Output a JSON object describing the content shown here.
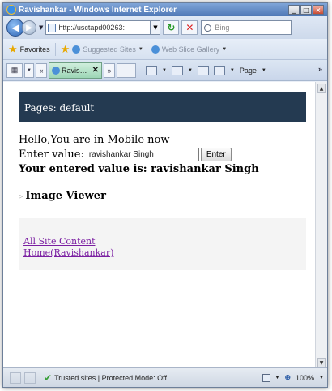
{
  "window": {
    "title": "Ravishankar - Windows Internet Explorer",
    "controls": [
      "_",
      "□",
      "×"
    ]
  },
  "addressbar": {
    "url": "http://usctapd00263:",
    "search_placeholder": "Bing"
  },
  "favorites_bar": {
    "favorites_label": "Favorites",
    "items": [
      "Suggested Sites",
      "Web Slice Gallery"
    ]
  },
  "tabbar": {
    "tab_label": "Ravis…",
    "page_menu": "Page",
    "more": "»",
    "scroll_left": "«",
    "scroll_right": "»"
  },
  "page": {
    "header": "Pages: default",
    "greeting": "Hello,You are in Mobile now",
    "enter_label": "Enter value:",
    "input_value": "ravishankar Singh",
    "enter_button": "Enter",
    "result": "Your entered value is: ravishankar Singh",
    "image_viewer": "Image Viewer",
    "links": [
      "All Site Content",
      "Home(Ravishankar)"
    ]
  },
  "statusbar": {
    "zone": "Trusted sites | Protected Mode: Off",
    "zoom": "100%"
  }
}
